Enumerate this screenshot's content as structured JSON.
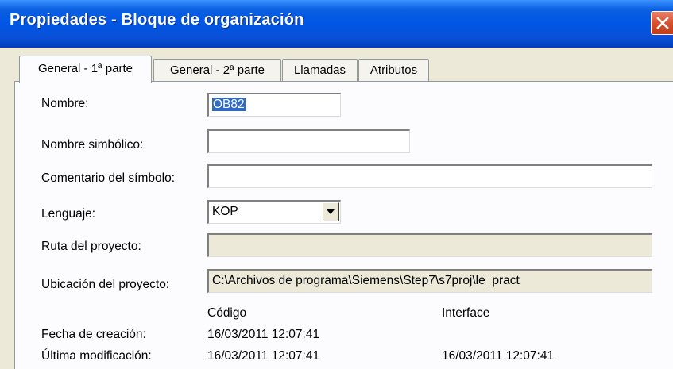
{
  "window": {
    "title": "Propiedades - Bloque de organización",
    "close_icon": "close-icon"
  },
  "tabs": [
    {
      "label": "General - 1ª parte",
      "active": true
    },
    {
      "label": "General - 2ª parte",
      "active": false
    },
    {
      "label": "Llamadas",
      "active": false
    },
    {
      "label": "Atributos",
      "active": false
    }
  ],
  "form": {
    "nombre": {
      "label": "Nombre:",
      "value": "OB82"
    },
    "nombre_simbolico": {
      "label": "Nombre simbólico:",
      "value": ""
    },
    "comentario": {
      "label": "Comentario del símbolo:",
      "value": ""
    },
    "lenguaje": {
      "label": "Lenguaje:",
      "value": "KOP"
    },
    "ruta": {
      "label": "Ruta del proyecto:",
      "value": ""
    },
    "ubicacion": {
      "label": "Ubicación del proyecto:",
      "value": "C:\\Archivos de programa\\Siemens\\Step7\\s7proj\\le_pract"
    }
  },
  "dates": {
    "col_codigo": "Código",
    "col_interface": "Interface",
    "creacion_label": "Fecha de creación:",
    "creacion_codigo": "16/03/2011 12:07:41",
    "modificacion_label": "Última modificación:",
    "modificacion_codigo": "16/03/2011 12:07:41",
    "modificacion_interface": "16/03/2011 12:07:41"
  }
}
